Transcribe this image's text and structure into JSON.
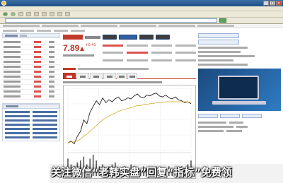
{
  "window": {
    "title": "",
    "controls": [
      "_",
      "□",
      "×"
    ]
  },
  "browser": {
    "menus": [
      "",
      "",
      "",
      "",
      "",
      ""
    ],
    "address_label": "",
    "address_value": ""
  },
  "stock": {
    "price": "7.89",
    "change": "+0.41",
    "change_pct": "",
    "trend": "up",
    "accent_color": "#c0392b"
  },
  "chart_tabs": [
    {
      "label": "",
      "active": true
    },
    {
      "label": "",
      "active": false
    },
    {
      "label": "",
      "active": false
    },
    {
      "label": "",
      "active": false
    },
    {
      "label": "",
      "active": false
    },
    {
      "label": "",
      "active": false
    }
  ],
  "chart_data": {
    "type": "line",
    "title": "",
    "xlabel": "",
    "ylabel": "",
    "series": [
      {
        "values": [
          7.48,
          7.5,
          7.47,
          7.55,
          7.6,
          7.72,
          7.68,
          7.8,
          7.86,
          7.92,
          7.88,
          7.95,
          7.9,
          7.93,
          7.91,
          7.94,
          7.96,
          7.92,
          7.93,
          7.95,
          7.94,
          7.97,
          7.99,
          7.96,
          7.95,
          7.98,
          7.97,
          7.99,
          8.0,
          7.97,
          7.96,
          7.98,
          7.95,
          7.94,
          7.96,
          7.93,
          7.92,
          7.9,
          7.91,
          7.89
        ],
        "color": "#222222"
      },
      {
        "values": [
          7.48,
          7.49,
          7.49,
          7.5,
          7.52,
          7.55,
          7.57,
          7.6,
          7.63,
          7.66,
          7.69,
          7.72,
          7.74,
          7.76,
          7.78,
          7.79,
          7.81,
          7.82,
          7.83,
          7.84,
          7.85,
          7.86,
          7.87,
          7.87,
          7.88,
          7.88,
          7.89,
          7.89,
          7.9,
          7.9,
          7.9,
          7.91,
          7.91,
          7.91,
          7.91,
          7.91,
          7.91,
          7.91,
          7.91,
          7.9
        ],
        "color": "#d4a017"
      }
    ],
    "volume": [
      9,
      6,
      5,
      7,
      8,
      10,
      6,
      9,
      11,
      8,
      5,
      6,
      4,
      5,
      6,
      7,
      4,
      3,
      5,
      4,
      6,
      5,
      4,
      3,
      5,
      4,
      3,
      4,
      5,
      3,
      4,
      3,
      5,
      4,
      3,
      4,
      5,
      4,
      6,
      8
    ],
    "ylim": [
      7.4,
      8.05
    ],
    "grid": true,
    "panels": [
      "price",
      "volume"
    ]
  },
  "caption": "关注微信“老韩实盘”回复“指标”免费领"
}
